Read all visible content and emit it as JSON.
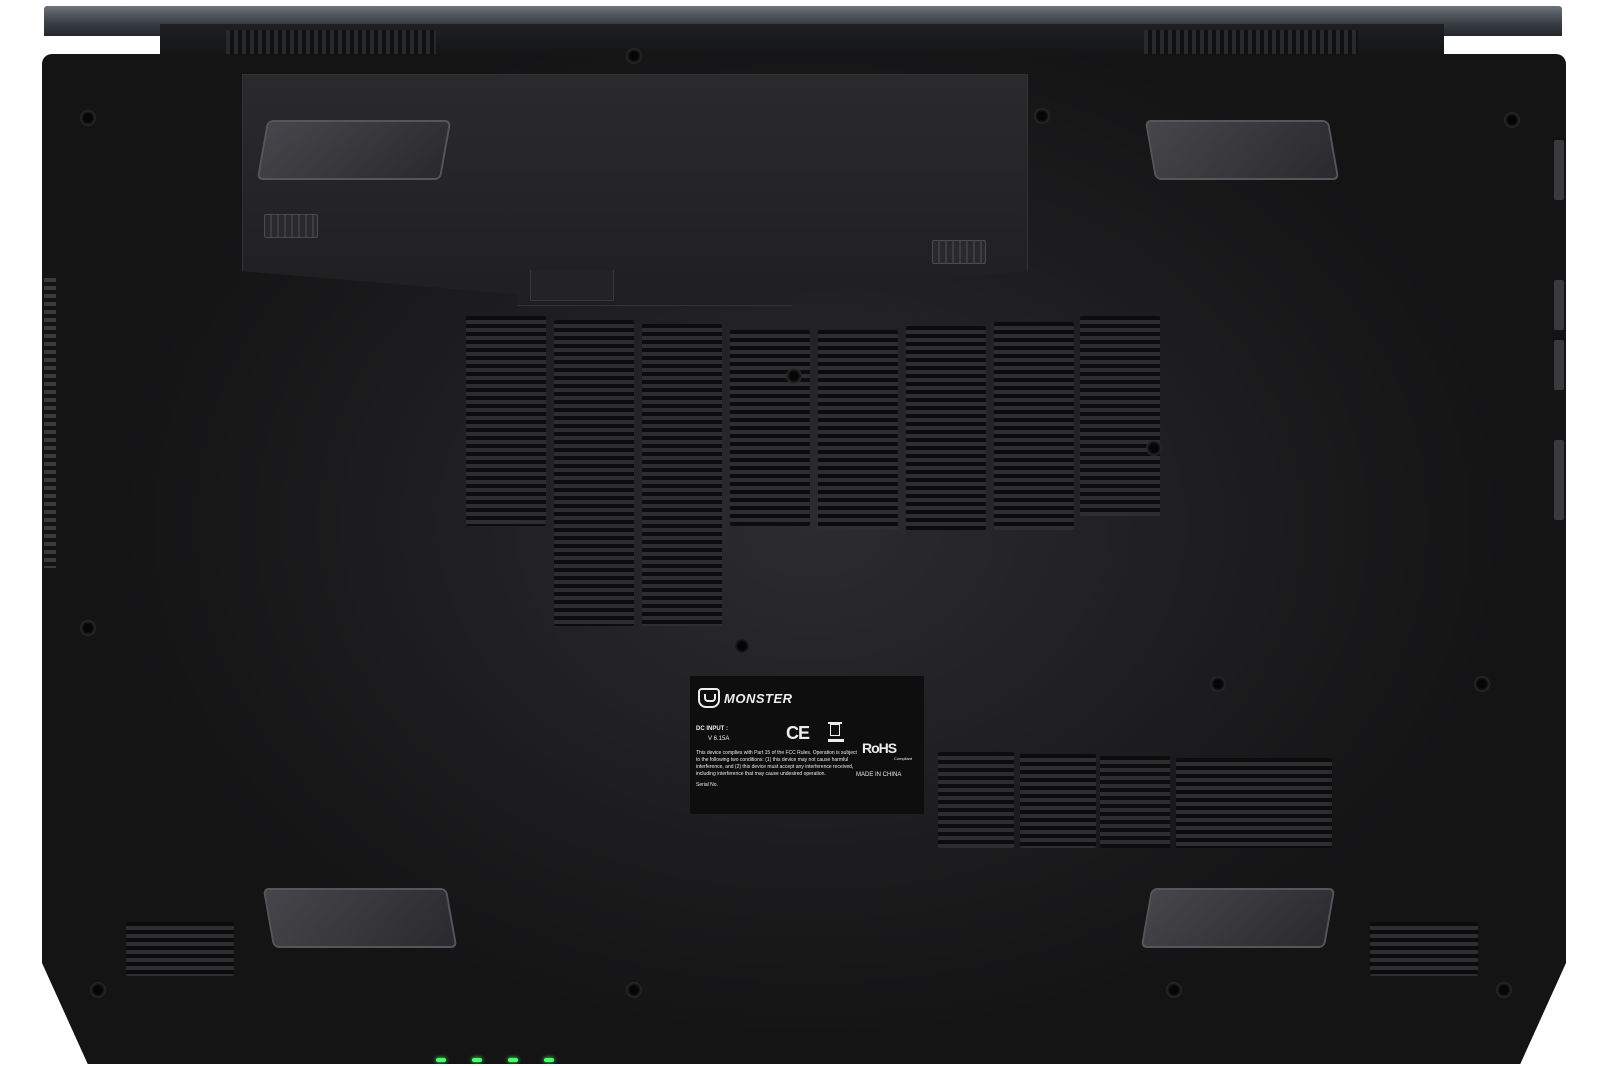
{
  "image": {
    "subject": "Laptop bottom panel",
    "colors": {
      "chassis": "#1d1d1f",
      "lid": "#4a4f57",
      "led": "#4cff6a",
      "label": "#0e0e0f"
    }
  },
  "label": {
    "brand": "MONSTER",
    "dc_input": "DC INPUT :",
    "dc_value": "V      6.15A",
    "ce_mark": "CE",
    "fcc_text": "This device complies with Part 15 of the FCC Rules. Operation is subject to the following two conditions: (1) this device may not cause harmful interference, and (2) this device must accept any interference received, including interference that may cause undesired operation.",
    "serial": "Serial No.",
    "rohs": "RoHS",
    "rohs_sub": "Compliant",
    "made_in": "MADE IN CHINA"
  }
}
